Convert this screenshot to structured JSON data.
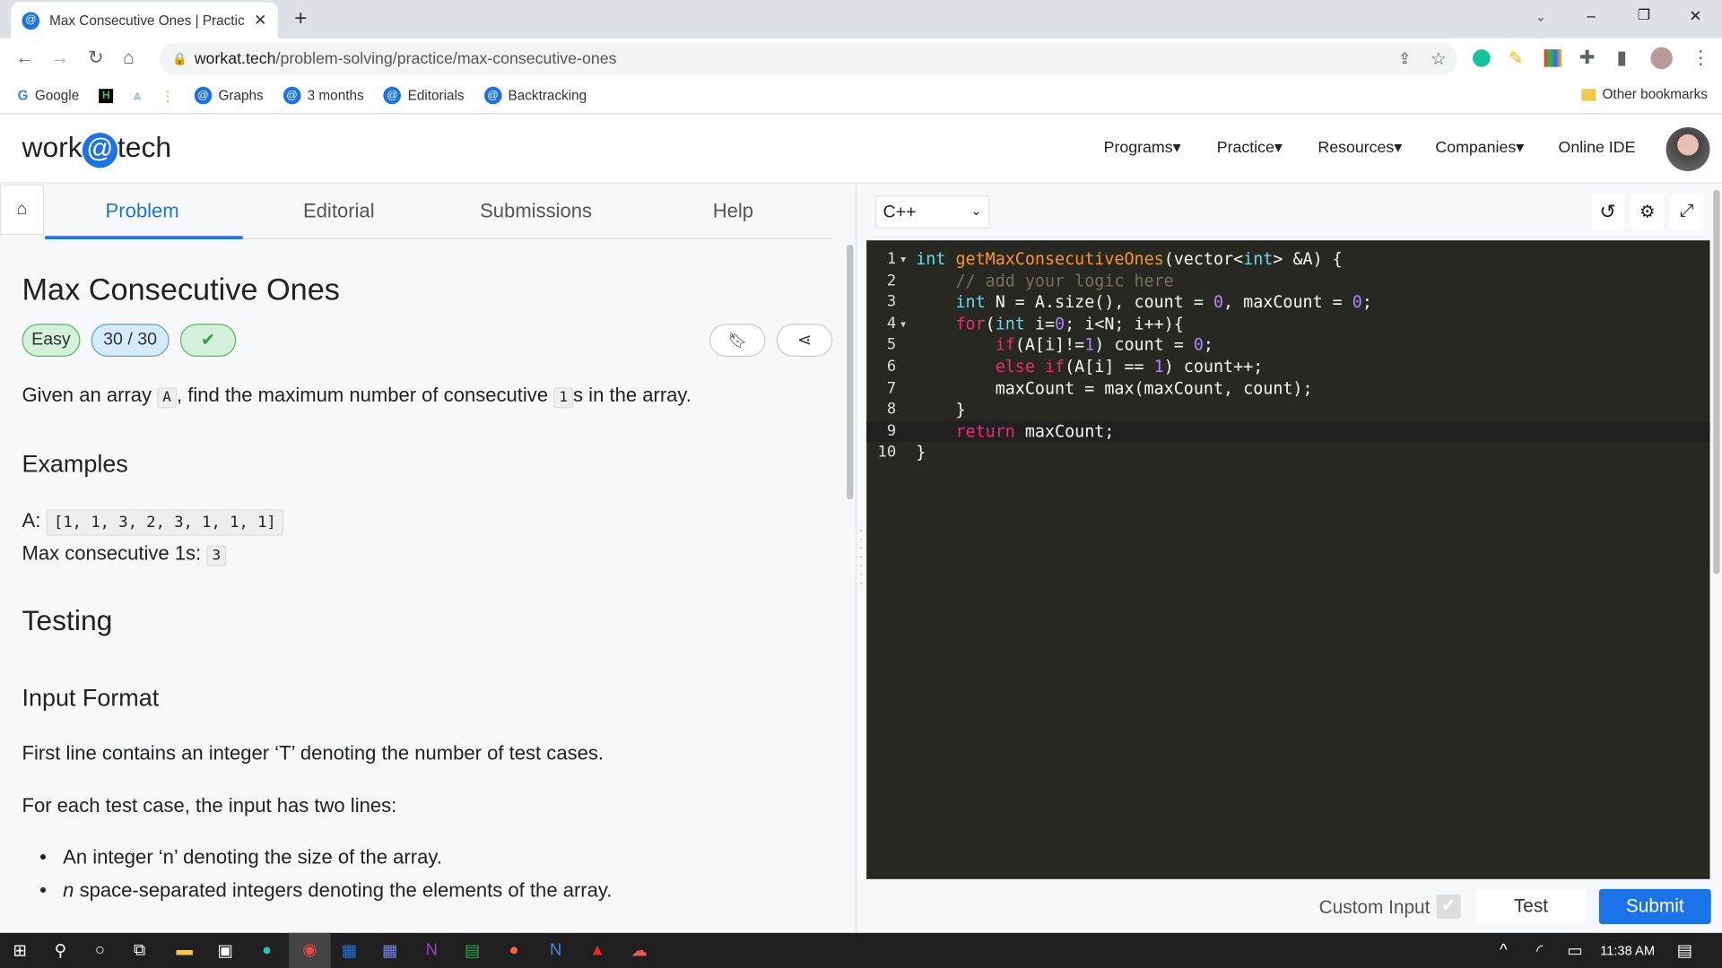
{
  "browser": {
    "tab_title": "Max Consecutive Ones | Practice",
    "url_domain": "workat.tech",
    "url_path": "/problem-solving/practice/max-consecutive-ones",
    "bookmarks": [
      "Google",
      "Graphs",
      "3 months",
      "Editorials",
      "Backtracking"
    ],
    "other_bookmarks": "Other bookmarks"
  },
  "site": {
    "logo_left": "work",
    "logo_at": "@",
    "logo_right": "tech",
    "nav": [
      "Programs",
      "Practice",
      "Resources",
      "Companies",
      "Online IDE"
    ]
  },
  "problem": {
    "tabs": [
      "Problem",
      "Editorial",
      "Submissions",
      "Help"
    ],
    "active_tab": "Problem",
    "title": "Max Consecutive Ones",
    "difficulty": "Easy",
    "score": "30 / 30",
    "desc_1": "Given an array ",
    "desc_code_1": "A",
    "desc_2": ", find the maximum number of consecutive ",
    "desc_code_2": "1",
    "desc_3": "s in the array.",
    "examples_heading": "Examples",
    "example_label_a": "A:",
    "example_a": "[1, 1, 3, 2, 3, 1, 1, 1]",
    "example_label_out": "Max consecutive 1s:",
    "example_out": "3",
    "testing_heading": "Testing",
    "input_format_heading": "Input Format",
    "input_line_1": "First line contains an integer ‘T’ denoting the number of test cases.",
    "input_line_2": "For each test case, the input has two lines:",
    "bullet_1": "An integer ‘n’ denoting the size of the array.",
    "bullet_2_em": "n",
    "bullet_2": " space-separated integers denoting the elements of the array."
  },
  "editor": {
    "language": "C++",
    "active_line": 9,
    "colors": {
      "background": "#272822",
      "type": "#66d9ef",
      "function": "#fd971f",
      "keyword": "#f92672",
      "number": "#ae81ff",
      "comment": "#75715e",
      "text": "#f8f8f2"
    },
    "lines": [
      [
        [
          "type",
          "int"
        ],
        [
          "text",
          " "
        ],
        [
          "function",
          "getMaxConsecutiveOnes"
        ],
        [
          "text",
          "(vector<"
        ],
        [
          "type",
          "int"
        ],
        [
          "text",
          "> &A) {"
        ]
      ],
      [
        [
          "comment",
          "    // add your logic here"
        ]
      ],
      [
        [
          "text",
          "    "
        ],
        [
          "type",
          "int"
        ],
        [
          "text",
          " N = A.size(), count = "
        ],
        [
          "number",
          "0"
        ],
        [
          "text",
          ", maxCount = "
        ],
        [
          "number",
          "0"
        ],
        [
          "text",
          ";"
        ]
      ],
      [
        [
          "text",
          "    "
        ],
        [
          "keyword",
          "for"
        ],
        [
          "text",
          "("
        ],
        [
          "type",
          "int"
        ],
        [
          "text",
          " i="
        ],
        [
          "number",
          "0"
        ],
        [
          "text",
          "; i<N; i++){"
        ]
      ],
      [
        [
          "text",
          "        "
        ],
        [
          "keyword",
          "if"
        ],
        [
          "text",
          "(A[i]!="
        ],
        [
          "number",
          "1"
        ],
        [
          "text",
          ") count = "
        ],
        [
          "number",
          "0"
        ],
        [
          "text",
          ";"
        ]
      ],
      [
        [
          "text",
          "        "
        ],
        [
          "keyword",
          "else"
        ],
        [
          "text",
          " "
        ],
        [
          "keyword",
          "if"
        ],
        [
          "text",
          "(A[i] == "
        ],
        [
          "number",
          "1"
        ],
        [
          "text",
          ") count++;"
        ]
      ],
      [
        [
          "text",
          "        maxCount = max(maxCount, count);"
        ]
      ],
      [
        [
          "text",
          "    }"
        ]
      ],
      [
        [
          "text",
          "    "
        ],
        [
          "keyword",
          "return"
        ],
        [
          "text",
          " maxCount;"
        ]
      ],
      [
        [
          "text",
          "}"
        ]
      ]
    ],
    "folds": [
      1,
      4
    ],
    "custom_input_label": "Custom Input",
    "test_label": "Test",
    "submit_label": "Submit",
    "accent": "#1a73e8"
  },
  "taskbar": {
    "time": "11:38 AM"
  }
}
